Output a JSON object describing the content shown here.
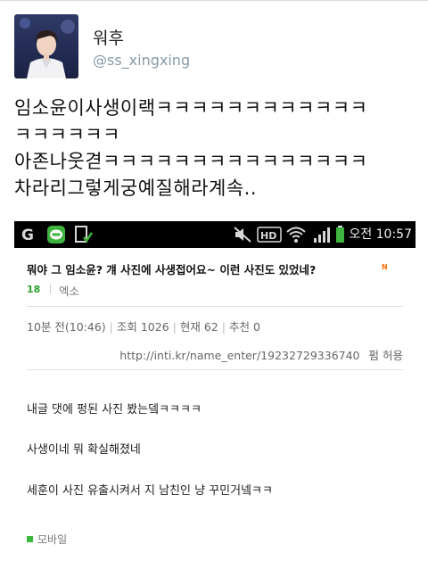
{
  "tweet": {
    "display_name": "워후",
    "handle": "@ss_xingxing",
    "lines": [
      "임소윤이사생이랙ㅋㅋㅋㅋㅋㅋㅋㅋㅋㅋㅋㅋ",
      "ㅋㅋㅋㅋㅋㅋ",
      "아존나웃겯ㅋㅋㅋㅋㅋㅋㅋㅋㅋㅋㅋㅋㅋㅋㅋ",
      "차라리그렇게궁예질해라계속.."
    ]
  },
  "screenshot": {
    "status_bar": {
      "carrier_icon": "G",
      "clock": "오전 10:57"
    },
    "post": {
      "title": "뭐야 그 임소윤? 걔 사진에 사생접어요~ 이런 사진도 있었네?",
      "new_mark": "N",
      "reply_count": "18",
      "board": "엑소",
      "time": "10분 전(10:46)",
      "views": "조회 1026",
      "current": "현재 62",
      "recommend": "추천 0",
      "url": "http://inti.kr/name_enter/19232729336740",
      "permission": "펌 허용",
      "body": [
        "내글 댓에 펑된 사진 봤는뎈ㅋㅋㅋㅋ",
        "사생이네 뭐 확실해졌네",
        "세훈이 사진 유출시켜서 지 남친인 냥 꾸민거넼ㅋㅋ"
      ],
      "mobile_label": "모바일"
    }
  }
}
